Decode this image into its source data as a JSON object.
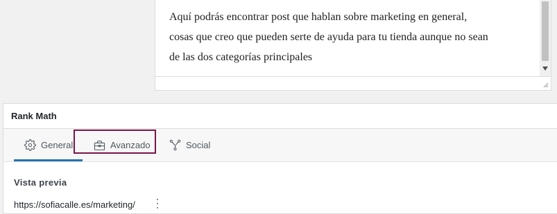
{
  "editor": {
    "lines": [
      "Aquí podrás encontrar post que hablan sobre marketing en general,",
      "cosas que creo que pueden serte de ayuda para tu tienda aunque no sean",
      "de las dos categorías principales"
    ]
  },
  "rank_math": {
    "title": "Rank Math",
    "tabs": [
      {
        "label": "General",
        "icon": "gear-icon",
        "active": true
      },
      {
        "label": "Avanzado",
        "icon": "briefcase-icon",
        "active": false,
        "highlighted": true
      },
      {
        "label": "Social",
        "icon": "social-nodes-icon",
        "active": false
      }
    ],
    "preview": {
      "section_title": "Vista previa",
      "url": "https://sofiacalle.es/marketing/"
    }
  },
  "colors": {
    "active_tab_underline": "#2271b1",
    "highlight_box": "#7a1448"
  }
}
